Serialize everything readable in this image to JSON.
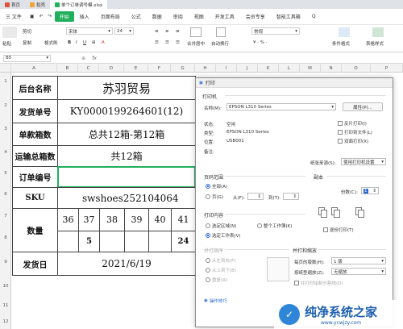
{
  "tabs": [
    {
      "label": "首页",
      "icon_color": "#e0533a"
    },
    {
      "label": "稻壳",
      "icon_color": "#f2a43a"
    },
    {
      "label": "单个订单调号模.xlsx",
      "icon_color": "#20b05b"
    }
  ],
  "menu": {
    "file_label": "三 文件",
    "items": [
      "开始",
      "插入",
      "页面布局",
      "公式",
      "数据",
      "审阅",
      "视图",
      "开发工具",
      "会员专享",
      "智能工具箱"
    ],
    "search_label": "Q"
  },
  "toolbar": {
    "paste_label": "粘贴",
    "cut_label": "剪切",
    "copy_label": "复制",
    "format_painter_label": "格式刷",
    "font_name": "宋体",
    "font_size": "24",
    "merge_label": "合并居中",
    "wrap_label": "自动换行",
    "number_format": "常规",
    "cond_format_label": "条件格式",
    "table_style_label": "表格样式"
  },
  "formula_bar": {
    "cell_ref": "B5",
    "fx": "fx"
  },
  "columns": [
    "A",
    "B",
    "C",
    "D",
    "E",
    "F",
    "G",
    "H",
    "I",
    "J",
    "K",
    "L",
    "M",
    "N",
    "O",
    "P"
  ],
  "rows": [
    "1",
    "2",
    "3",
    "4",
    "5",
    "6",
    "7",
    "8",
    "9",
    "10",
    "11",
    "12"
  ],
  "sheet": {
    "company_label": "后台名称",
    "company_value": "苏羽贸易",
    "shipping_no_label": "发货单号",
    "shipping_no_value": "KY0000199264601(12)",
    "box_label": "单款箱数",
    "box_value": "总共12箱-第12箱",
    "total_box_label": "运输总箱数",
    "total_box_value": "共12箱",
    "order_no_label": "订单编号",
    "order_no_value": "",
    "sku_label": "SKU",
    "sku_value": "swshoes252104064",
    "qty_label": "数量",
    "sizes": [
      "36",
      "37",
      "38",
      "39",
      "40",
      "41"
    ],
    "qty_37": "5",
    "qty_41": "24",
    "date_label": "发货日",
    "date_value": "2021/6/19"
  },
  "dialog": {
    "title": "打印",
    "printer_section": "打印机",
    "name_label": "名称(M):",
    "printer_name": "EPSON L310 Series",
    "properties_btn": "属性(P)...",
    "status_label": "状态:",
    "status_value": "空闲",
    "type_label": "类型:",
    "type_value": "EPSON L310 Series",
    "location_label": "位置:",
    "location_value": "USB001",
    "comment_label": "备注:",
    "reverse_print": "反片打印(I)",
    "print_to_file": "打印到文件(L)",
    "duplex": "双面打印(X)",
    "paper_source_label": "纸张来源(S):",
    "paper_source_value": "使用打印机设置",
    "range_section": "页码范围",
    "all_label": "全部(A)",
    "pages_label": "页(G)",
    "from_label": "从(F):",
    "to_label": "到(T):",
    "copies_section": "副本",
    "copies_label": "份数(C):",
    "copies_value": "1",
    "collate_label": "逐份打印(T)",
    "content_section": "打印内容",
    "selection_label": "选定区域(N)",
    "workbook_label": "整个工作簿(K)",
    "active_sheet_label": "选定工作表(V)",
    "order_section": "并打顺序",
    "order_lr": "从左到右(F)",
    "order_tb": "从上到下(B)",
    "order_repeat": "重复(R)",
    "scale_section": "并打和缩放",
    "pages_per_sheet_label": "每页的版数(H):",
    "pages_per_sheet_value": "1 版",
    "scale_paper_label": "按纸型缩放(Z):",
    "scale_paper_value": "无缩放",
    "print_borders_label": "并打时绘制分割线(D)",
    "tips_label": "操作技巧"
  },
  "watermark": {
    "title": "纯净系统之家",
    "url": "www.ycwjzy.com"
  }
}
